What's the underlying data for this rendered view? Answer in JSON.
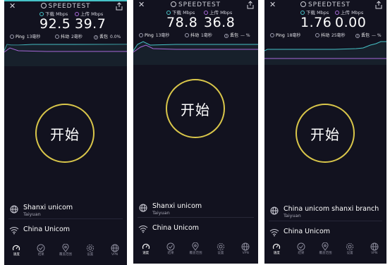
{
  "logo": "SPEEDTEST",
  "labels": {
    "download": "下载 Mbps",
    "upload": "上传 Mbps",
    "ping": "Ping",
    "jitter": "抖动",
    "loss": "丢包"
  },
  "colors": {
    "background": "#12121f",
    "download": "#46c2c7",
    "upload": "#a768d9",
    "start_ring": "#d9c64a"
  },
  "icons": [
    "close-icon",
    "share-icon",
    "globe-icon",
    "wifi-icon",
    "speed-gauge-icon",
    "check-icon",
    "location-icon",
    "settings-icon",
    "globe-nav-icon"
  ],
  "nav": [
    "速度",
    "结果",
    "覆盖范围",
    "设置",
    "VPN"
  ],
  "panels": [
    {
      "download": "92.5",
      "upload": "39.7",
      "ping": "13毫秒",
      "jitter": "2毫秒",
      "loss": "0.0%",
      "start": "开始",
      "server": "Shanxi unicom",
      "city": "Taiyuan",
      "isp": "China Unicom"
    },
    {
      "download": "78.8",
      "upload": "36.8",
      "ping": "13毫秒",
      "jitter": "1毫秒",
      "loss": "— %",
      "start": "开始",
      "server": "Shanxi unicom",
      "city": "Taiyuan",
      "isp": "China Unicom"
    },
    {
      "download": "1.76",
      "upload": "0.00",
      "ping": "18毫秒",
      "jitter": "25毫秒",
      "loss": "— %",
      "start": "开始",
      "server": "China unicom shanxi branch",
      "city": "Taiyuan",
      "isp": "China Unicom"
    }
  ]
}
